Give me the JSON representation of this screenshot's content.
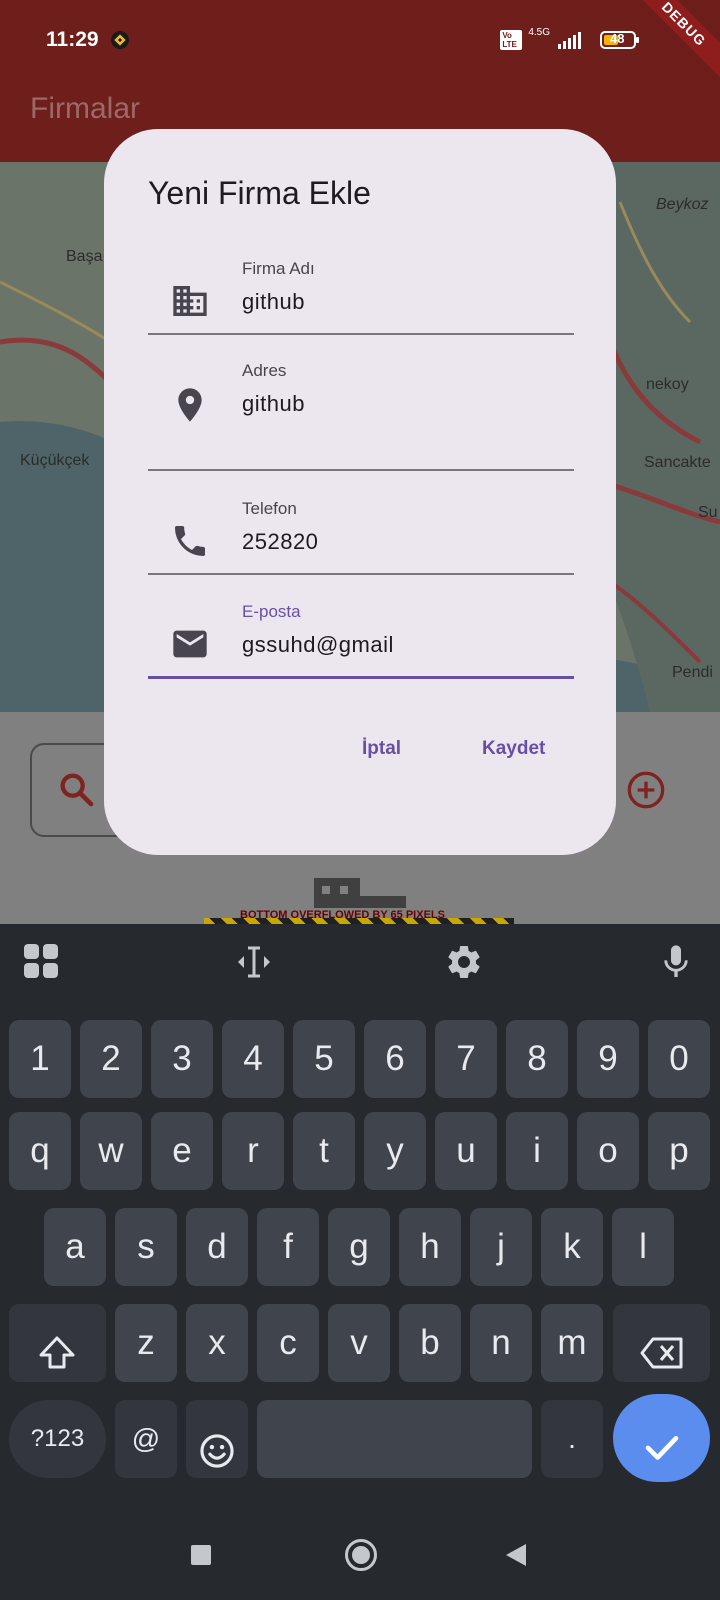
{
  "status": {
    "time": "11:29",
    "network": "4.5G",
    "volte": "Vo LTE",
    "battery": "48"
  },
  "debug_banner": "DEBUG",
  "appbar": {
    "title": "Firmalar"
  },
  "map": {
    "labels": [
      "Başa",
      "Beykoz",
      "nekoy",
      "Küçükçek",
      "Sancakte",
      "Su",
      "Pendi"
    ]
  },
  "dialog": {
    "title": "Yeni Firma Ekle",
    "fields": [
      {
        "label": "Firma Adı",
        "value": "github",
        "icon": "business-icon"
      },
      {
        "label": "Adres",
        "value": "github",
        "icon": "location-pin-icon"
      },
      {
        "label": "Telefon",
        "value": "252820",
        "icon": "phone-icon"
      },
      {
        "label": "E-posta",
        "value": "gssuhd@gmail",
        "icon": "mail-icon"
      }
    ],
    "cancel_label": "İptal",
    "save_label": "Kaydet"
  },
  "overflow_warning": "BOTTOM OVERFLOWED BY 65 PIXELS",
  "keyboard": {
    "row_numbers": [
      "1",
      "2",
      "3",
      "4",
      "5",
      "6",
      "7",
      "8",
      "9",
      "0"
    ],
    "row1": [
      "q",
      "w",
      "e",
      "r",
      "t",
      "y",
      "u",
      "i",
      "o",
      "p"
    ],
    "row2": [
      "a",
      "s",
      "d",
      "f",
      "g",
      "h",
      "j",
      "k",
      "l"
    ],
    "row3": [
      "z",
      "x",
      "c",
      "v",
      "b",
      "n",
      "m"
    ],
    "symbols_label": "?123",
    "at_label": "@",
    "period_label": "."
  },
  "colors": {
    "appbar": "#6e1e1b",
    "dialog_bg": "#ece6ef",
    "accent": "#6750a4",
    "keyboard_bg": "#262a2f",
    "key_bg": "#40454d",
    "enter_key": "#5b8def"
  }
}
